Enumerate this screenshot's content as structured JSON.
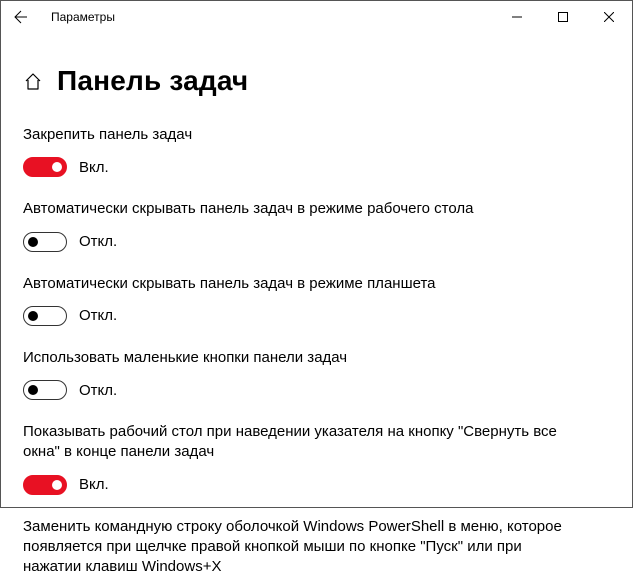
{
  "window": {
    "title": "Параметры"
  },
  "page": {
    "title": "Панель задач"
  },
  "labels": {
    "on": "Вкл.",
    "off": "Откл."
  },
  "settings": [
    {
      "label": "Закрепить панель задач",
      "enabled": true
    },
    {
      "label": "Автоматически скрывать панель задач в режиме рабочего стола",
      "enabled": false
    },
    {
      "label": "Автоматически скрывать панель задач в режиме планшета",
      "enabled": false
    },
    {
      "label": "Использовать маленькие кнопки панели задач",
      "enabled": false
    },
    {
      "label": "Показывать рабочий стол при наведении указателя на кнопку \"Свернуть все окна\" в конце панели задач",
      "enabled": true
    }
  ],
  "footer": "Заменить командную строку оболочкой Windows PowerShell в меню, которое появляется при щелчке правой кнопкой мыши по кнопке \"Пуск\" или при нажатии клавиш Windows+X"
}
